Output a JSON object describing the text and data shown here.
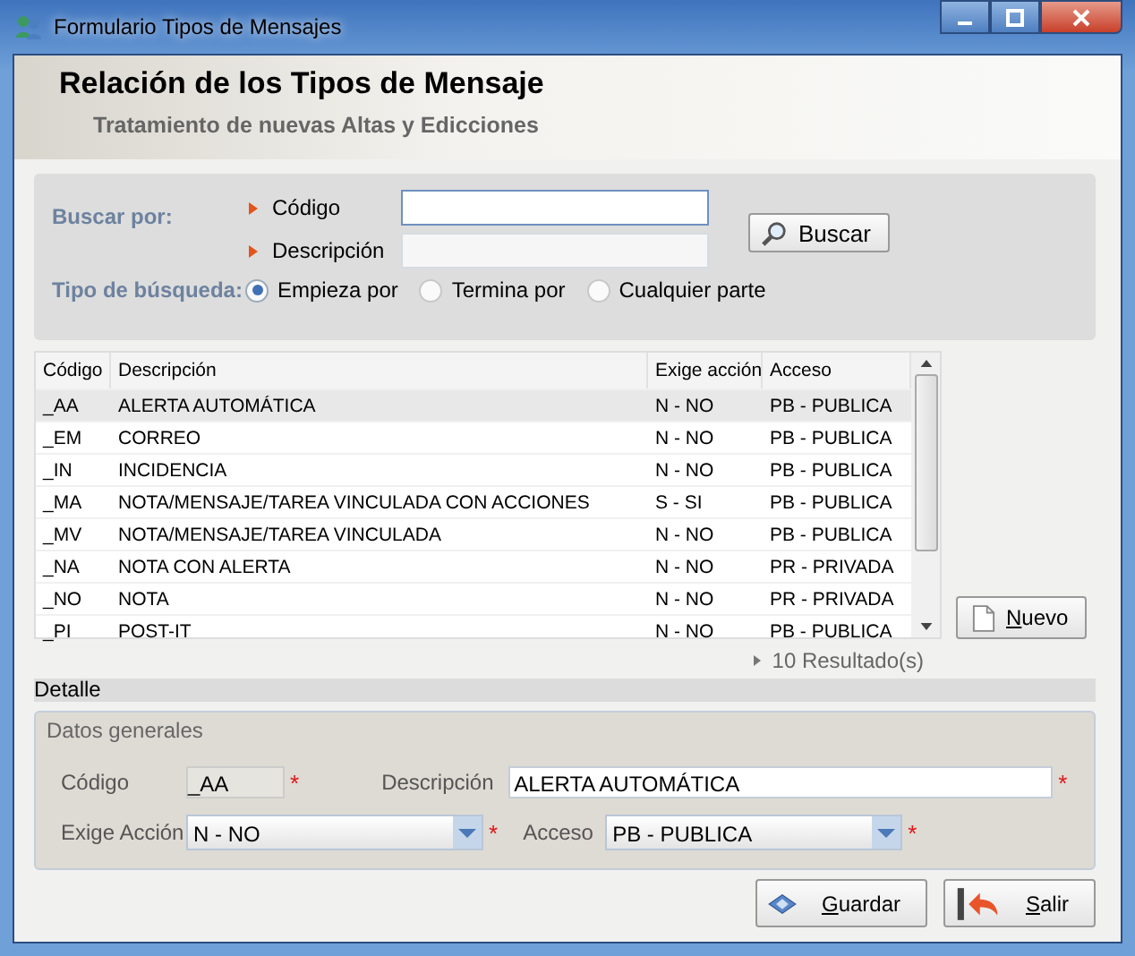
{
  "window": {
    "title": "Formulario Tipos de Mensajes"
  },
  "header": {
    "title": "Relación de los Tipos de Mensaje",
    "subtitle": "Tratamiento de nuevas Altas y Edicciones"
  },
  "search": {
    "label": "Buscar por:",
    "fields": [
      {
        "label": "Código",
        "focused": true
      },
      {
        "label": "Descripción",
        "focused": false
      }
    ],
    "button": "Buscar",
    "type_label": "Tipo de búsqueda:",
    "options": [
      {
        "label": "Empieza por",
        "selected": true
      },
      {
        "label": "Termina por",
        "selected": false
      },
      {
        "label": "Cualquier parte",
        "selected": false
      }
    ]
  },
  "table": {
    "columns": [
      "Código",
      "Descripción",
      "Exige acción",
      "Acceso"
    ],
    "rows": [
      {
        "cells": [
          "_AA",
          "ALERTA AUTOMÁTICA",
          "N - NO",
          "PB - PUBLICA"
        ],
        "selected": true
      },
      {
        "cells": [
          "_EM",
          "CORREO",
          "N - NO",
          "PB - PUBLICA"
        ],
        "selected": false
      },
      {
        "cells": [
          "_IN",
          "INCIDENCIA",
          "N - NO",
          "PB - PUBLICA"
        ],
        "selected": false
      },
      {
        "cells": [
          "_MA",
          "NOTA/MENSAJE/TAREA VINCULADA CON ACCIONES",
          "S - SI",
          "PB - PUBLICA"
        ],
        "selected": false
      },
      {
        "cells": [
          "_MV",
          "NOTA/MENSAJE/TAREA VINCULADA",
          "N - NO",
          "PB - PUBLICA"
        ],
        "selected": false
      },
      {
        "cells": [
          "_NA",
          "NOTA CON ALERTA",
          "N - NO",
          "PR - PRIVADA"
        ],
        "selected": false
      },
      {
        "cells": [
          "_NO",
          "NOTA",
          "N - NO",
          "PR - PRIVADA"
        ],
        "selected": false
      },
      {
        "cells": [
          "_PI",
          "POST-IT",
          "N - NO",
          "PB - PUBLICA"
        ],
        "selected": false
      }
    ],
    "results": "10 Resultado(s)"
  },
  "new_button": "Nuevo",
  "detail": {
    "title": "Detalle",
    "group": "Datos generales",
    "codigo": {
      "label": "Código",
      "value": "_AA",
      "required": "*"
    },
    "descripcion": {
      "label": "Descripción",
      "value": "ALERTA AUTOMÁTICA",
      "required": "*"
    },
    "exige": {
      "label": "Exige Acción",
      "value": "N - NO",
      "required": "*"
    },
    "acceso": {
      "label": "Acceso",
      "value": "PB - PUBLICA",
      "required": "*"
    }
  },
  "buttons": [
    {
      "label": "Guardar",
      "kind": "save"
    },
    {
      "label": "Salir",
      "kind": "exit"
    }
  ]
}
